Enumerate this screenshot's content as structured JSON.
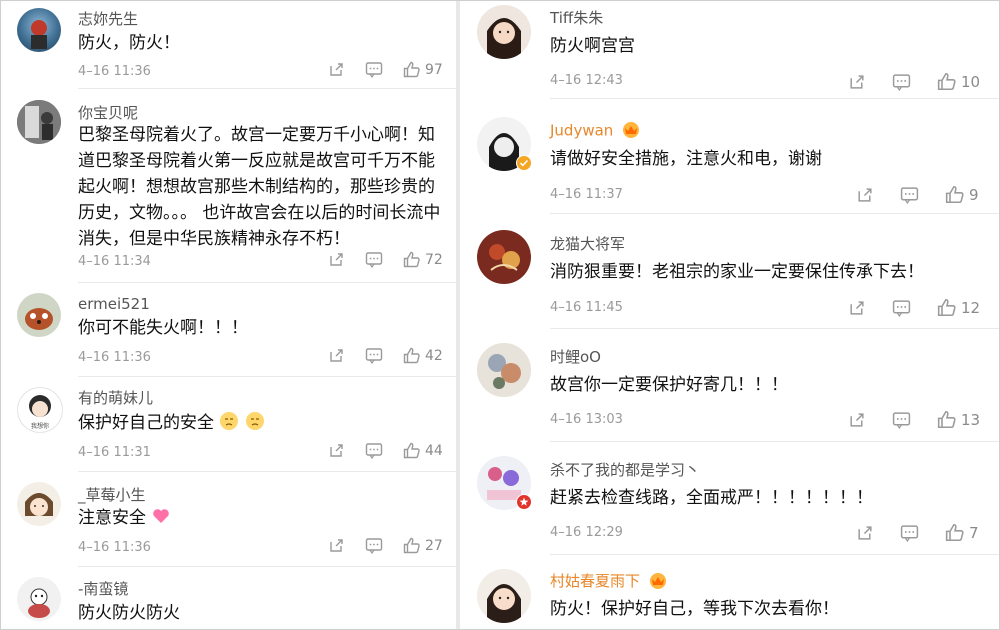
{
  "left_comments": [
    {
      "name": "志妳先生",
      "text": "防火，防火！",
      "time": "4–16 11:36",
      "likes": "97"
    },
    {
      "name": "你宝贝呢",
      "text": "巴黎圣母院着火了。故宫一定要万千小心啊！知道巴黎圣母院着火第一反应就是故宫可千万不能起火啊！想想故宫那些木制结构的，那些珍贵的历史，文物。。。  也许故宫会在以后的时间长流中消失，但是中华民族精神永存不朽！",
      "time": "4–16 11:34",
      "likes": "72"
    },
    {
      "name": "ermei521",
      "text": "你可不能失火啊！！！",
      "time": "4–16 11:36",
      "likes": "42"
    },
    {
      "name": "有的萌妹儿",
      "text": "保护好自己的安全",
      "time": "4–16 11:31",
      "likes": "44"
    },
    {
      "name": "_草莓小生",
      "text": "注意安全",
      "time": "4–16 11:36",
      "likes": "27"
    },
    {
      "name": "-南蛮镜",
      "text": "防火防火防火",
      "time": "",
      "likes": ""
    }
  ],
  "right_comments": [
    {
      "name": "Tiff朱朱",
      "text": "防火啊宫宫",
      "time": "4–16 12:43",
      "likes": "10"
    },
    {
      "name": "Judywan",
      "text": "请做好安全措施，注意火和电，谢谢",
      "time": "4–16 11:37",
      "likes": "9"
    },
    {
      "name": "龙猫大将军",
      "text": "消防狠重要！老祖宗的家业一定要保住传承下去！",
      "time": "4–16 11:45",
      "likes": "12"
    },
    {
      "name": "时鲤oO",
      "text": "故宫你一定要保护好寄几！！！",
      "time": "4–16 13:03",
      "likes": "13"
    },
    {
      "name": "杀不了我的都是学习丶",
      "text": "赶紧去检查线路，全面戒严！！！！！！！",
      "time": "4–16 12:29",
      "likes": "7"
    },
    {
      "name": "村姑春夏雨下",
      "text": "防火！保护好自己，等我下次去看你！",
      "time": "",
      "likes": ""
    }
  ],
  "colors": {
    "name": "#555555",
    "vip_name": "#e8872a",
    "time": "#9a9a9a",
    "separator": "#e9e9e9",
    "icon": "#9a9a9a"
  },
  "icons": {
    "share": "share-icon",
    "comment": "comment-icon",
    "like": "thumbs-up-icon"
  }
}
